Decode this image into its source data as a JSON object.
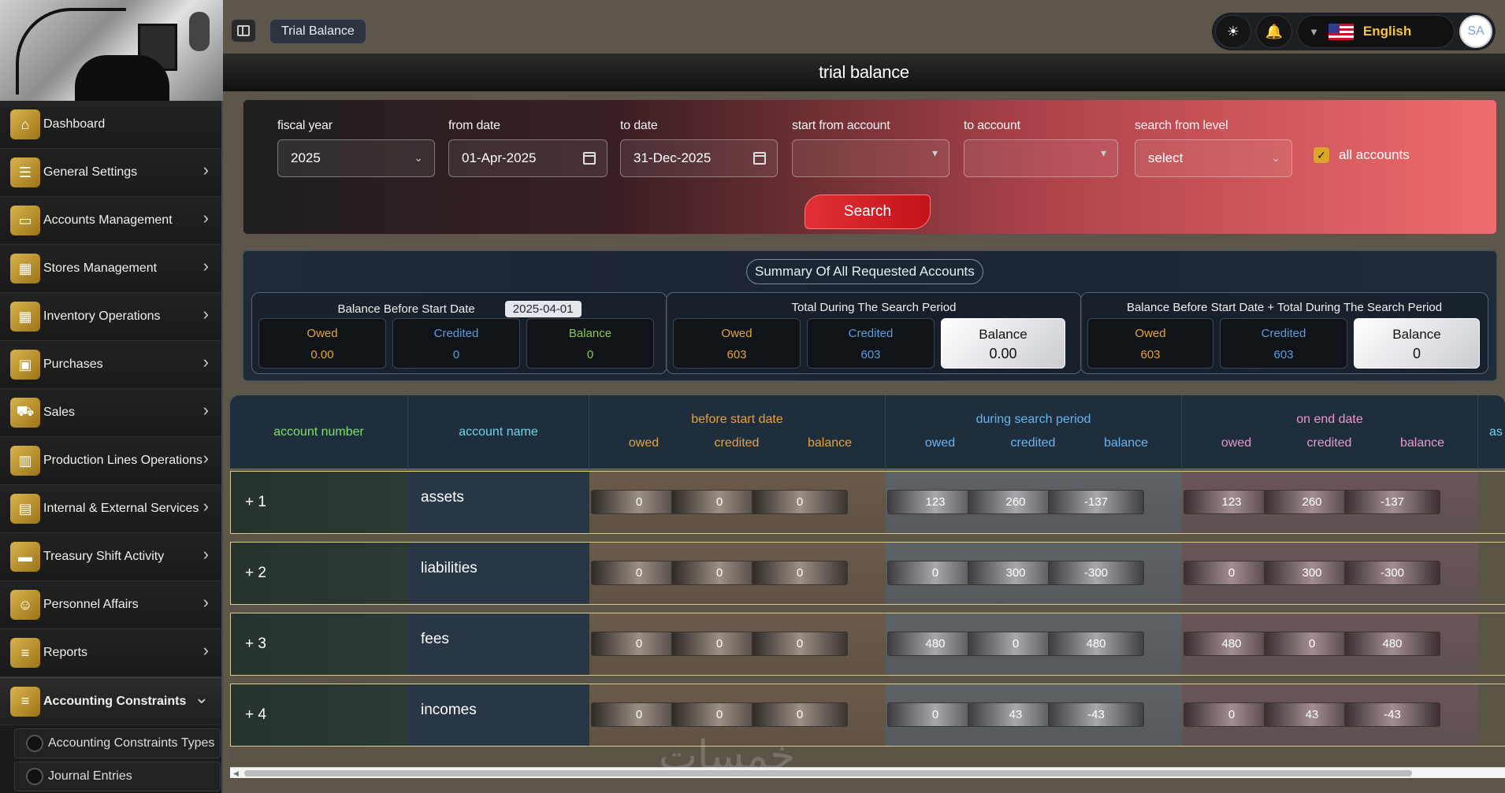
{
  "sidebar": {
    "items": [
      {
        "label": "Dashboard",
        "icon": "home-icon",
        "has_chevron": false
      },
      {
        "label": "General Settings",
        "icon": "sliders-icon",
        "has_chevron": true
      },
      {
        "label": "Accounts Management",
        "icon": "wallet-icon",
        "has_chevron": true
      },
      {
        "label": "Stores Management",
        "icon": "building-icon",
        "has_chevron": true
      },
      {
        "label": "Inventory Operations",
        "icon": "building-icon",
        "has_chevron": true
      },
      {
        "label": "Purchases",
        "icon": "bag-icon",
        "has_chevron": true
      },
      {
        "label": "Sales",
        "icon": "cart-icon",
        "has_chevron": true
      },
      {
        "label": "Production Lines Operations",
        "icon": "columns-icon",
        "has_chevron": true
      },
      {
        "label": "Internal & External Services",
        "icon": "document-icon",
        "has_chevron": true
      },
      {
        "label": "Treasury Shift Activity",
        "icon": "card-icon",
        "has_chevron": true
      },
      {
        "label": "Personnel Affairs",
        "icon": "people-icon",
        "has_chevron": true
      },
      {
        "label": "Reports",
        "icon": "list-icon",
        "has_chevron": true
      },
      {
        "label": "Accounting Constraints",
        "icon": "list-icon",
        "has_chevron": true,
        "active": true
      }
    ],
    "sub_items": [
      "Accounting Constraints Types",
      "Journal Entries"
    ]
  },
  "topbar": {
    "page_chip": "Trial Balance",
    "language": "English",
    "avatar": "SA"
  },
  "page_title": "trial balance",
  "filters": {
    "fiscal_year": {
      "label": "fiscal year",
      "value": "2025"
    },
    "from_date": {
      "label": "from date",
      "value": "01-Apr-2025"
    },
    "to_date": {
      "label": "to date",
      "value": "31-Dec-2025"
    },
    "start_account": {
      "label": "start from account",
      "value": ""
    },
    "to_account": {
      "label": "to account",
      "value": ""
    },
    "level": {
      "label": "search from level",
      "value": "select"
    },
    "all_accounts": {
      "label": "all accounts",
      "checked": true
    },
    "search_label": "Search"
  },
  "summary": {
    "title": "Summary Of All Requested Accounts",
    "before": {
      "title": "Balance Before Start Date",
      "date": "2025-04-01",
      "owed_label": "Owed",
      "owed": "0.00",
      "credited_label": "Credited",
      "credited": "0",
      "balance_label": "Balance",
      "balance": "0"
    },
    "during": {
      "title": "Total During The Search Period",
      "owed_label": "Owed",
      "owed": "603",
      "credited_label": "Credited",
      "credited": "603",
      "balance_label": "Balance",
      "balance": "0.00"
    },
    "combined": {
      "title": "Balance Before Start Date  +  Total During The Search Period",
      "owed_label": "Owed",
      "owed": "603",
      "credited_label": "Credited",
      "credited": "603",
      "balance_label": "Balance",
      "balance": "0"
    }
  },
  "table": {
    "headers": {
      "account_number": "account number",
      "account_name": "account name",
      "before": "before start date",
      "during": "during search period",
      "end": "on end date",
      "owed": "owed",
      "credited": "credited",
      "balance": "balance",
      "cut": "as"
    },
    "rows": [
      {
        "number": "+ 1",
        "name": "assets",
        "before": [
          "0",
          "0",
          "0"
        ],
        "during": [
          "123",
          "260",
          "-137"
        ],
        "end": [
          "123",
          "260",
          "-137"
        ]
      },
      {
        "number": "+ 2",
        "name": "liabilities",
        "before": [
          "0",
          "0",
          "0"
        ],
        "during": [
          "0",
          "300",
          "-300"
        ],
        "end": [
          "0",
          "300",
          "-300"
        ]
      },
      {
        "number": "+ 3",
        "name": "fees",
        "before": [
          "0",
          "0",
          "0"
        ],
        "during": [
          "480",
          "0",
          "480"
        ],
        "end": [
          "480",
          "0",
          "480"
        ]
      },
      {
        "number": "+ 4",
        "name": "incomes",
        "before": [
          "0",
          "0",
          "0"
        ],
        "during": [
          "0",
          "43",
          "-43"
        ],
        "end": [
          "0",
          "43",
          "-43"
        ]
      }
    ]
  },
  "watermark": "خمسات",
  "colors": {
    "accent_gold": "#d9a52b",
    "search_red": "#e23036",
    "owed": "#e3a53a",
    "credited": "#5a9de0",
    "balance": "#8bc94a"
  }
}
